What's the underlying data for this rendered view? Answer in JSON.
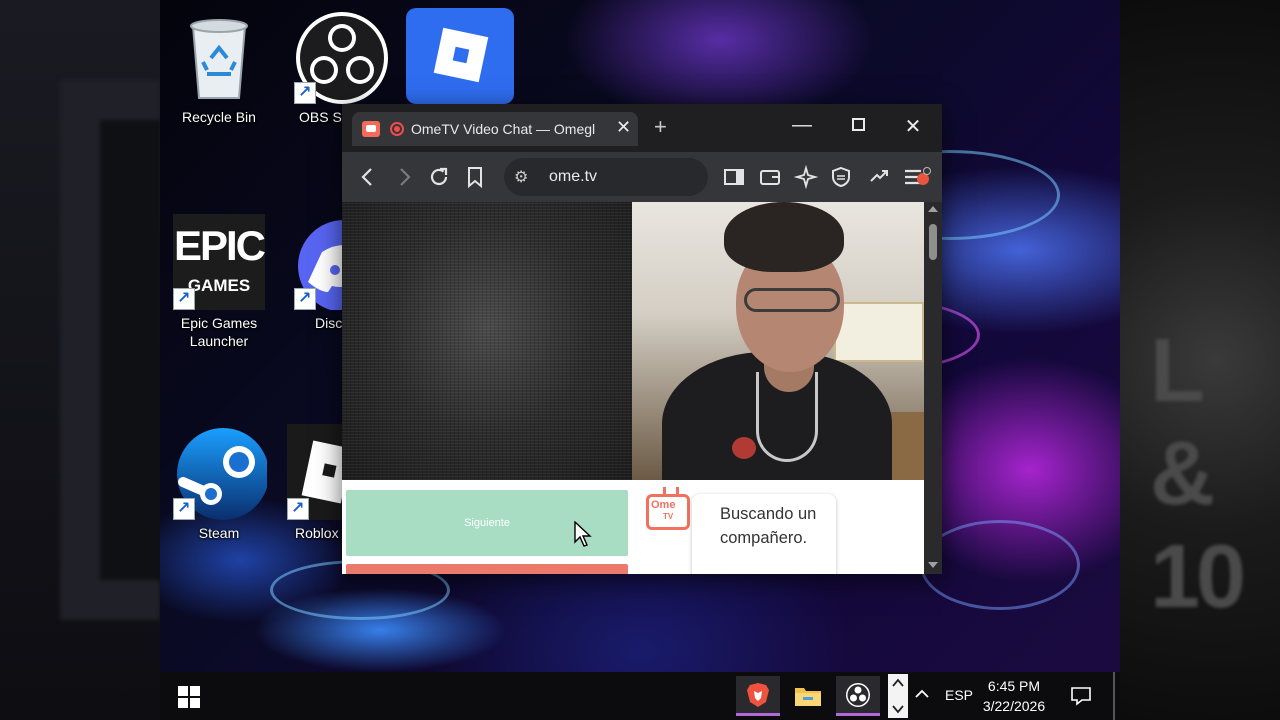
{
  "desktop_icons": [
    {
      "label": "Recycle Bin",
      "icon": "recycle-bin-icon"
    },
    {
      "label": "OBS S",
      "icon": "obs-icon"
    },
    {
      "label": "",
      "icon": "roblox-studio-icon"
    },
    {
      "label": "Epic Games Launcher",
      "icon": "epic-games-icon"
    },
    {
      "label": "Disc",
      "icon": "discord-icon"
    },
    {
      "label": "Steam",
      "icon": "steam-icon"
    },
    {
      "label": "Roblox",
      "icon": "roblox-icon"
    }
  ],
  "epic_logo": {
    "line1": "EPIC",
    "line2": "GAMES"
  },
  "browser": {
    "tab_title": "OmeTV Video Chat — Omegl",
    "url": "ome.tv",
    "accent": "#f26b5b"
  },
  "page": {
    "next_button": "Siguiente",
    "chat_status": "Buscando un compañero.",
    "logo_line1": "Ome",
    "logo_line2": "TV"
  },
  "taskbar": {
    "language": "ESP",
    "time": "6:45 PM",
    "date": "3/22/2026",
    "apps": [
      "brave-icon",
      "file-explorer-icon",
      "obs-icon"
    ]
  },
  "background_text": "L & 10"
}
